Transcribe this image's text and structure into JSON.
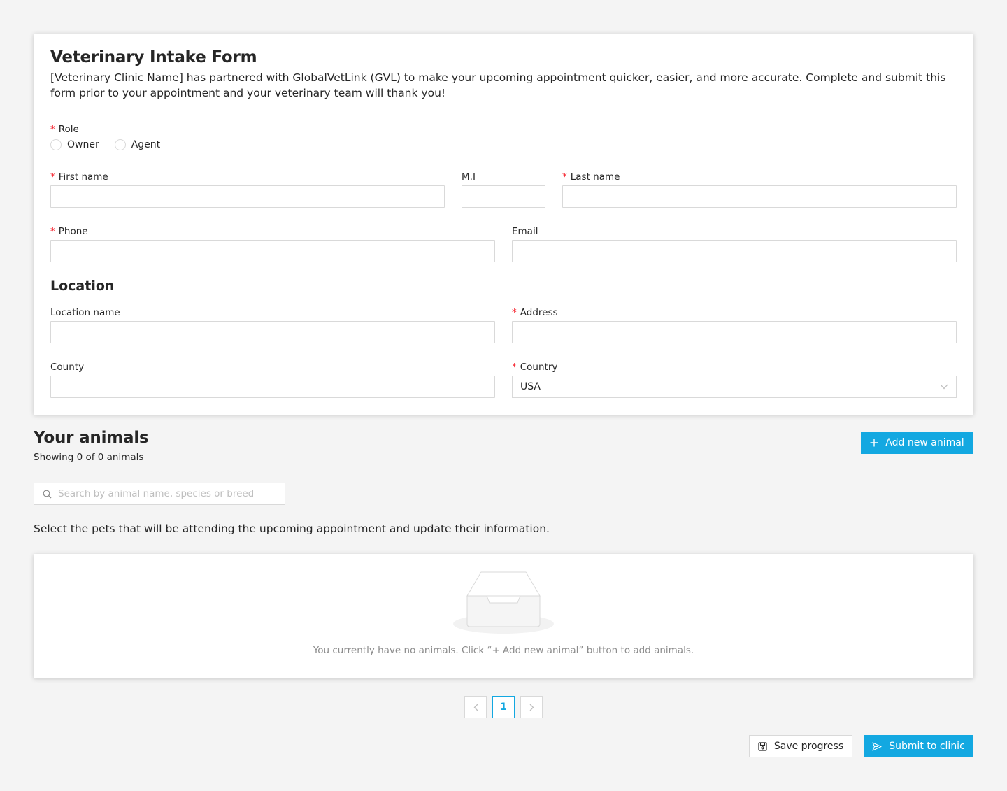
{
  "form": {
    "title": "Veterinary Intake Form",
    "description": "[Veterinary Clinic Name] has partnered with GlobalVetLink (GVL) to make your upcoming appointment quicker, easier, and more accurate. Complete and submit this form prior to your appointment and your veterinary team will thank you!",
    "role": {
      "label": "Role",
      "required": "*",
      "options": [
        "Owner",
        "Agent"
      ]
    },
    "fields": {
      "first_name": {
        "label": "First name",
        "value": ""
      },
      "mi": {
        "label": "M.I",
        "value": ""
      },
      "last_name": {
        "label": "Last name",
        "value": ""
      },
      "phone": {
        "label": "Phone",
        "value": ""
      },
      "email": {
        "label": "Email",
        "value": ""
      }
    },
    "location": {
      "title": "Location",
      "location_name": {
        "label": "Location name",
        "value": ""
      },
      "address": {
        "label": "Address",
        "value": ""
      },
      "county": {
        "label": "County",
        "value": ""
      },
      "country": {
        "label": "Country",
        "value": "USA"
      }
    }
  },
  "animals": {
    "title": "Your animals",
    "count_text": "Showing 0 of 0 animals",
    "add_button": "Add new animal",
    "search_placeholder": "Search by animal name, species or breed",
    "instructions": "Select the pets that will be attending the upcoming appointment and update their information.",
    "empty_text": "You currently have no animals. Click “+ Add new animal” button to add animals."
  },
  "pagination": {
    "current_page": "1",
    "prev_icon": "chevron-left-icon",
    "next_icon": "chevron-right-icon"
  },
  "footer": {
    "save_label": "Save progress",
    "submit_label": "Submit to clinic"
  },
  "colors": {
    "primary": "#13a8e1",
    "required": "#f5222d",
    "background": "#f4f4f4"
  }
}
